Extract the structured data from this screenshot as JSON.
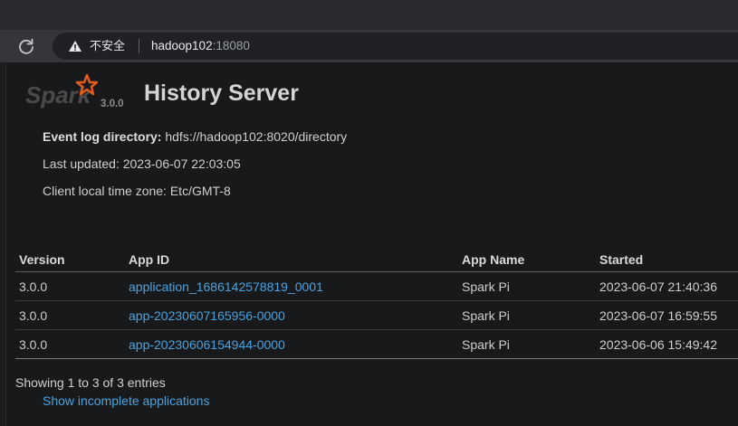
{
  "browser": {
    "security_label": "不安全",
    "url_host": "hadoop102",
    "url_port": ":18080"
  },
  "header": {
    "logo_text": "Spark",
    "spark_version": "3.0.0",
    "title": "History Server"
  },
  "info": {
    "event_log_label": "Event log directory:",
    "event_log_value": "hdfs://hadoop102:8020/directory",
    "last_updated": "Last updated: 2023-06-07 22:03:05",
    "timezone": "Client local time zone: Etc/GMT-8"
  },
  "table": {
    "headers": [
      "Version",
      "App ID",
      "App Name",
      "Started"
    ],
    "rows": [
      {
        "version": "3.0.0",
        "app_id": "application_1686142578819_0001",
        "app_name": "Spark Pi",
        "started": "2023-06-07 21:40:36"
      },
      {
        "version": "3.0.0",
        "app_id": "app-20230607165956-0000",
        "app_name": "Spark Pi",
        "started": "2023-06-07 16:59:55"
      },
      {
        "version": "3.0.0",
        "app_id": "app-20230606154944-0000",
        "app_name": "Spark Pi",
        "started": "2023-06-06 15:49:42"
      }
    ]
  },
  "footer": {
    "entries_text": "Showing 1 to 3 of 3 entries",
    "incomplete_link": "Show incomplete applications"
  },
  "colors": {
    "link": "#4aa3e0",
    "spark_orange": "#e25a1c"
  }
}
